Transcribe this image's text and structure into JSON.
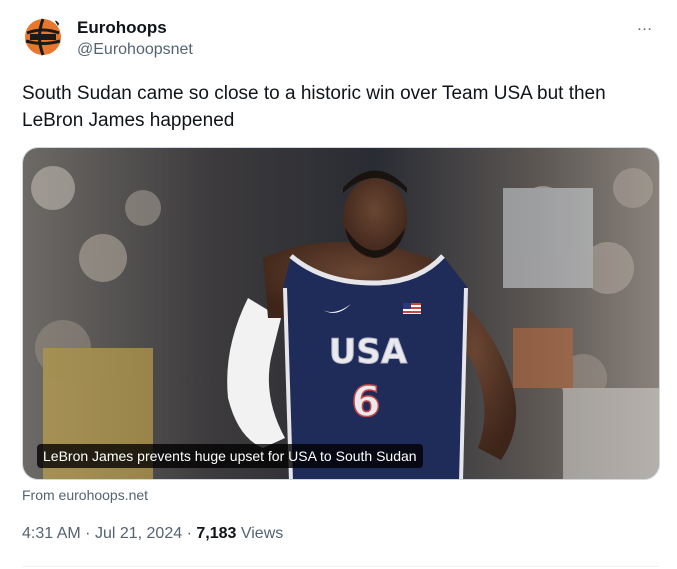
{
  "account": {
    "display_name": "Eurohoops",
    "handle": "@Eurohoopsnet"
  },
  "more_icon": "…",
  "tweet": {
    "text": "South Sudan came so close to a historic win over Team USA but then LeBron James happened"
  },
  "media": {
    "caption": "LeBron James prevents huge upset for USA to South Sudan",
    "jersey_text": "USA",
    "jersey_number": "6"
  },
  "link_source": "From eurohoops.net",
  "meta": {
    "time": "4:31 AM",
    "separator": "·",
    "date": "Jul 21, 2024",
    "views_count": "7,183",
    "views_label": "Views"
  },
  "colors": {
    "brand_orange": "#e8772e",
    "secondary_text": "#536471",
    "jersey_navy": "#1f2b58"
  }
}
